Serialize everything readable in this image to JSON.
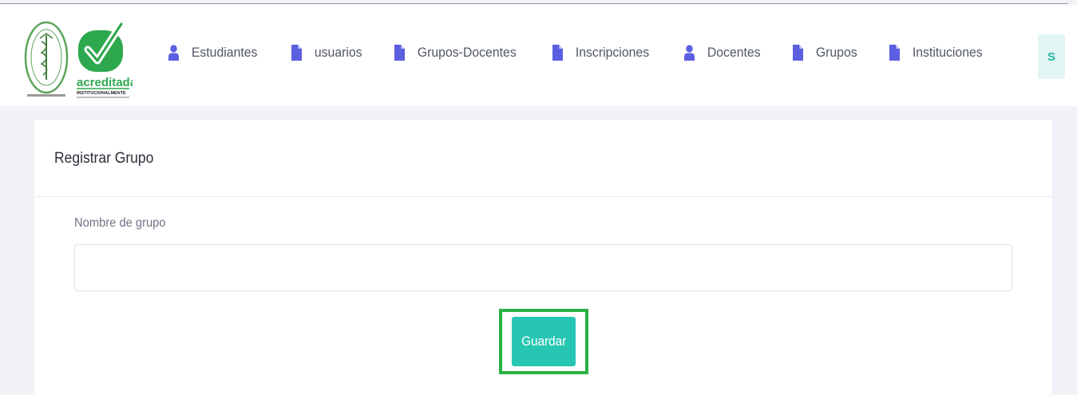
{
  "header": {
    "logos": {
      "seal": {
        "icon": "institution-seal-icon",
        "color": "#5aa55a"
      },
      "accreditation": {
        "text": "acreditada",
        "subtext": "INSTITUCIONALMENTE",
        "color": "#2ea84e"
      }
    },
    "nav": [
      {
        "label": "Estudiantes",
        "icon": "user-icon"
      },
      {
        "label": "usuarios",
        "icon": "document-icon"
      },
      {
        "label": "Grupos-Docentes",
        "icon": "document-icon"
      },
      {
        "label": "Inscripciones",
        "icon": "document-icon"
      },
      {
        "label": "Docentes",
        "icon": "user-icon"
      },
      {
        "label": "Grupos",
        "icon": "document-icon"
      },
      {
        "label": "Instituciones",
        "icon": "document-icon"
      }
    ],
    "avatar": {
      "initial": "S"
    },
    "icon_color": "#5b5fe0"
  },
  "form": {
    "title": "Registrar Grupo",
    "field_label": "Nombre de grupo",
    "field_value": "",
    "field_placeholder": "",
    "save_label": "Guardar"
  },
  "colors": {
    "accent": "#27c6b2",
    "highlight": "#2ab242",
    "page_bg": "#f1f2f8"
  }
}
